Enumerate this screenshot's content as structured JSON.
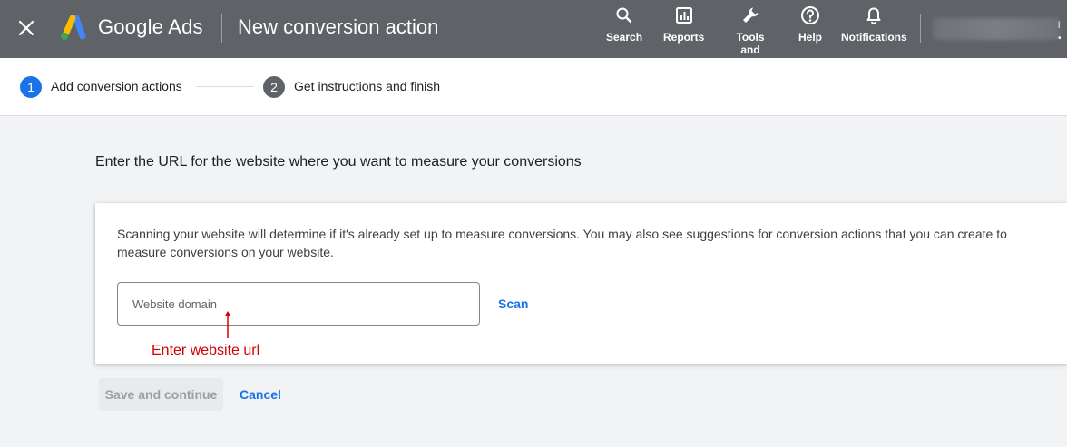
{
  "header": {
    "brand": "Google Ads",
    "page_title": "New conversion action",
    "nav": [
      {
        "label": "Search",
        "icon": "search-icon"
      },
      {
        "label": "Reports",
        "icon": "reports-icon"
      },
      {
        "label": "Tools and",
        "icon": "tools-icon"
      },
      {
        "label": "Help",
        "icon": "help-icon"
      },
      {
        "label": "Notifications",
        "icon": "bell-icon"
      }
    ],
    "close_icon": "close-icon"
  },
  "stepper": {
    "steps": [
      {
        "number": "1",
        "label": "Add conversion actions"
      },
      {
        "number": "2",
        "label": "Get instructions and finish"
      }
    ]
  },
  "main": {
    "prompt": "Enter the URL for the website where you want to measure your conversions",
    "card": {
      "description": "Scanning your website will determine if it's already set up to measure conversions. You may also see suggestions for conversion actions that you can create to measure conversions on your website.",
      "input_placeholder": "Website domain",
      "input_value": "",
      "scan_label": "Scan",
      "annotation": "Enter website url"
    },
    "save_label": "Save and continue",
    "cancel_label": "Cancel"
  },
  "colors": {
    "header_bg": "#5f6368",
    "accent": "#1a73e8",
    "annotation": "#d50000",
    "page_bg": "#f1f3f4"
  }
}
